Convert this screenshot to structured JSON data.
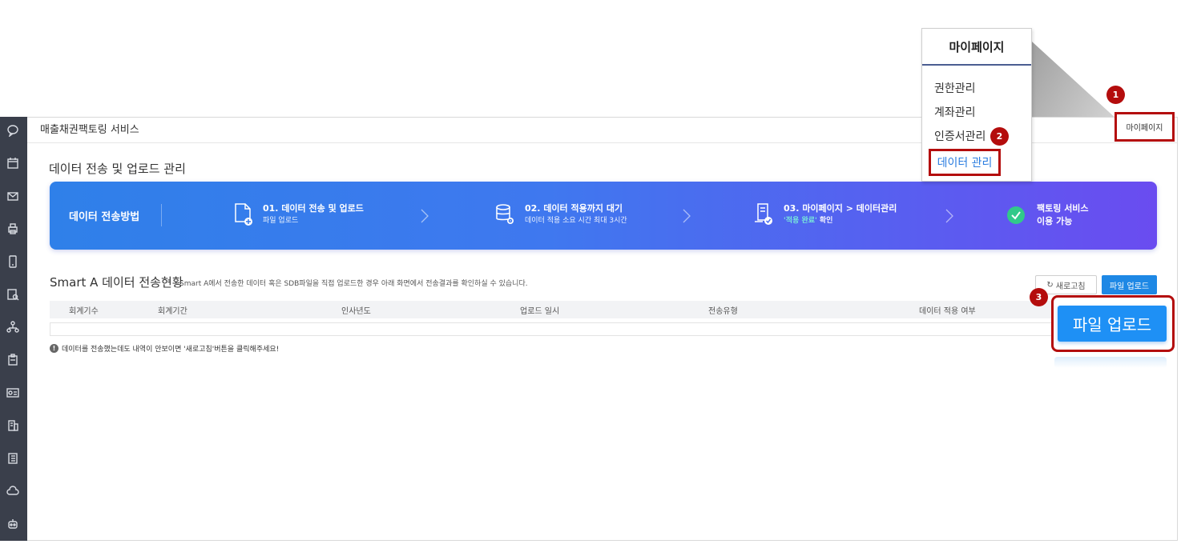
{
  "app": {
    "service_title": "매출채권팩토링 서비스"
  },
  "page": {
    "title": "데이터 전송 및 업로드 관리"
  },
  "banner": {
    "label": "데이터 전송방법",
    "steps": [
      {
        "title": "01. 데이터 전송 및 업로드",
        "desc": "파일 업로드",
        "icon": "file-add-icon"
      },
      {
        "title": "02. 데이터 적용까지 대기",
        "desc": "데이터 적용 소요 시간 최대 3시간",
        "icon": "database-gear-icon"
      },
      {
        "title": "03. 마이페이지 > 데이터관리",
        "desc_highlight": "'적용 완료'",
        "desc_rest": " 확인",
        "icon": "document-check-icon"
      },
      {
        "title": "팩토링 서비스",
        "desc": "이용 가능",
        "icon": "check-circle-icon"
      }
    ]
  },
  "section": {
    "title": "Smart A 데이터 전송현황",
    "desc": "Smart A에서 전송한 데이터 혹은 SDB파일을 직접 업로드한 경우 아래 화면에서 전송결과를 확인하실 수 있습니다.",
    "refresh_label": "새로고침",
    "upload_label": "파일 업로드"
  },
  "table": {
    "columns": [
      "회계기수",
      "회계기간",
      "인사년도",
      "업로드 일시",
      "전송유형",
      "데이터 적용 여부"
    ]
  },
  "notice": "데이터를 전송했는데도 내역이 안보이면 '새로고침'버튼을 클릭해주세요!",
  "mypage": {
    "link_label": "마이페이지",
    "menu_title": "마이페이지",
    "items": [
      "권한관리",
      "계좌관리",
      "인증서관리",
      "데이터 관리"
    ]
  },
  "markers": [
    "1",
    "2",
    "3"
  ],
  "zoom": {
    "upload_label": "파일 업로드"
  },
  "colors": {
    "accent": "#1e88e5",
    "highlight": "#b40d0d",
    "banner_start": "#2f80e9",
    "banner_end": "#6a4cf0"
  }
}
